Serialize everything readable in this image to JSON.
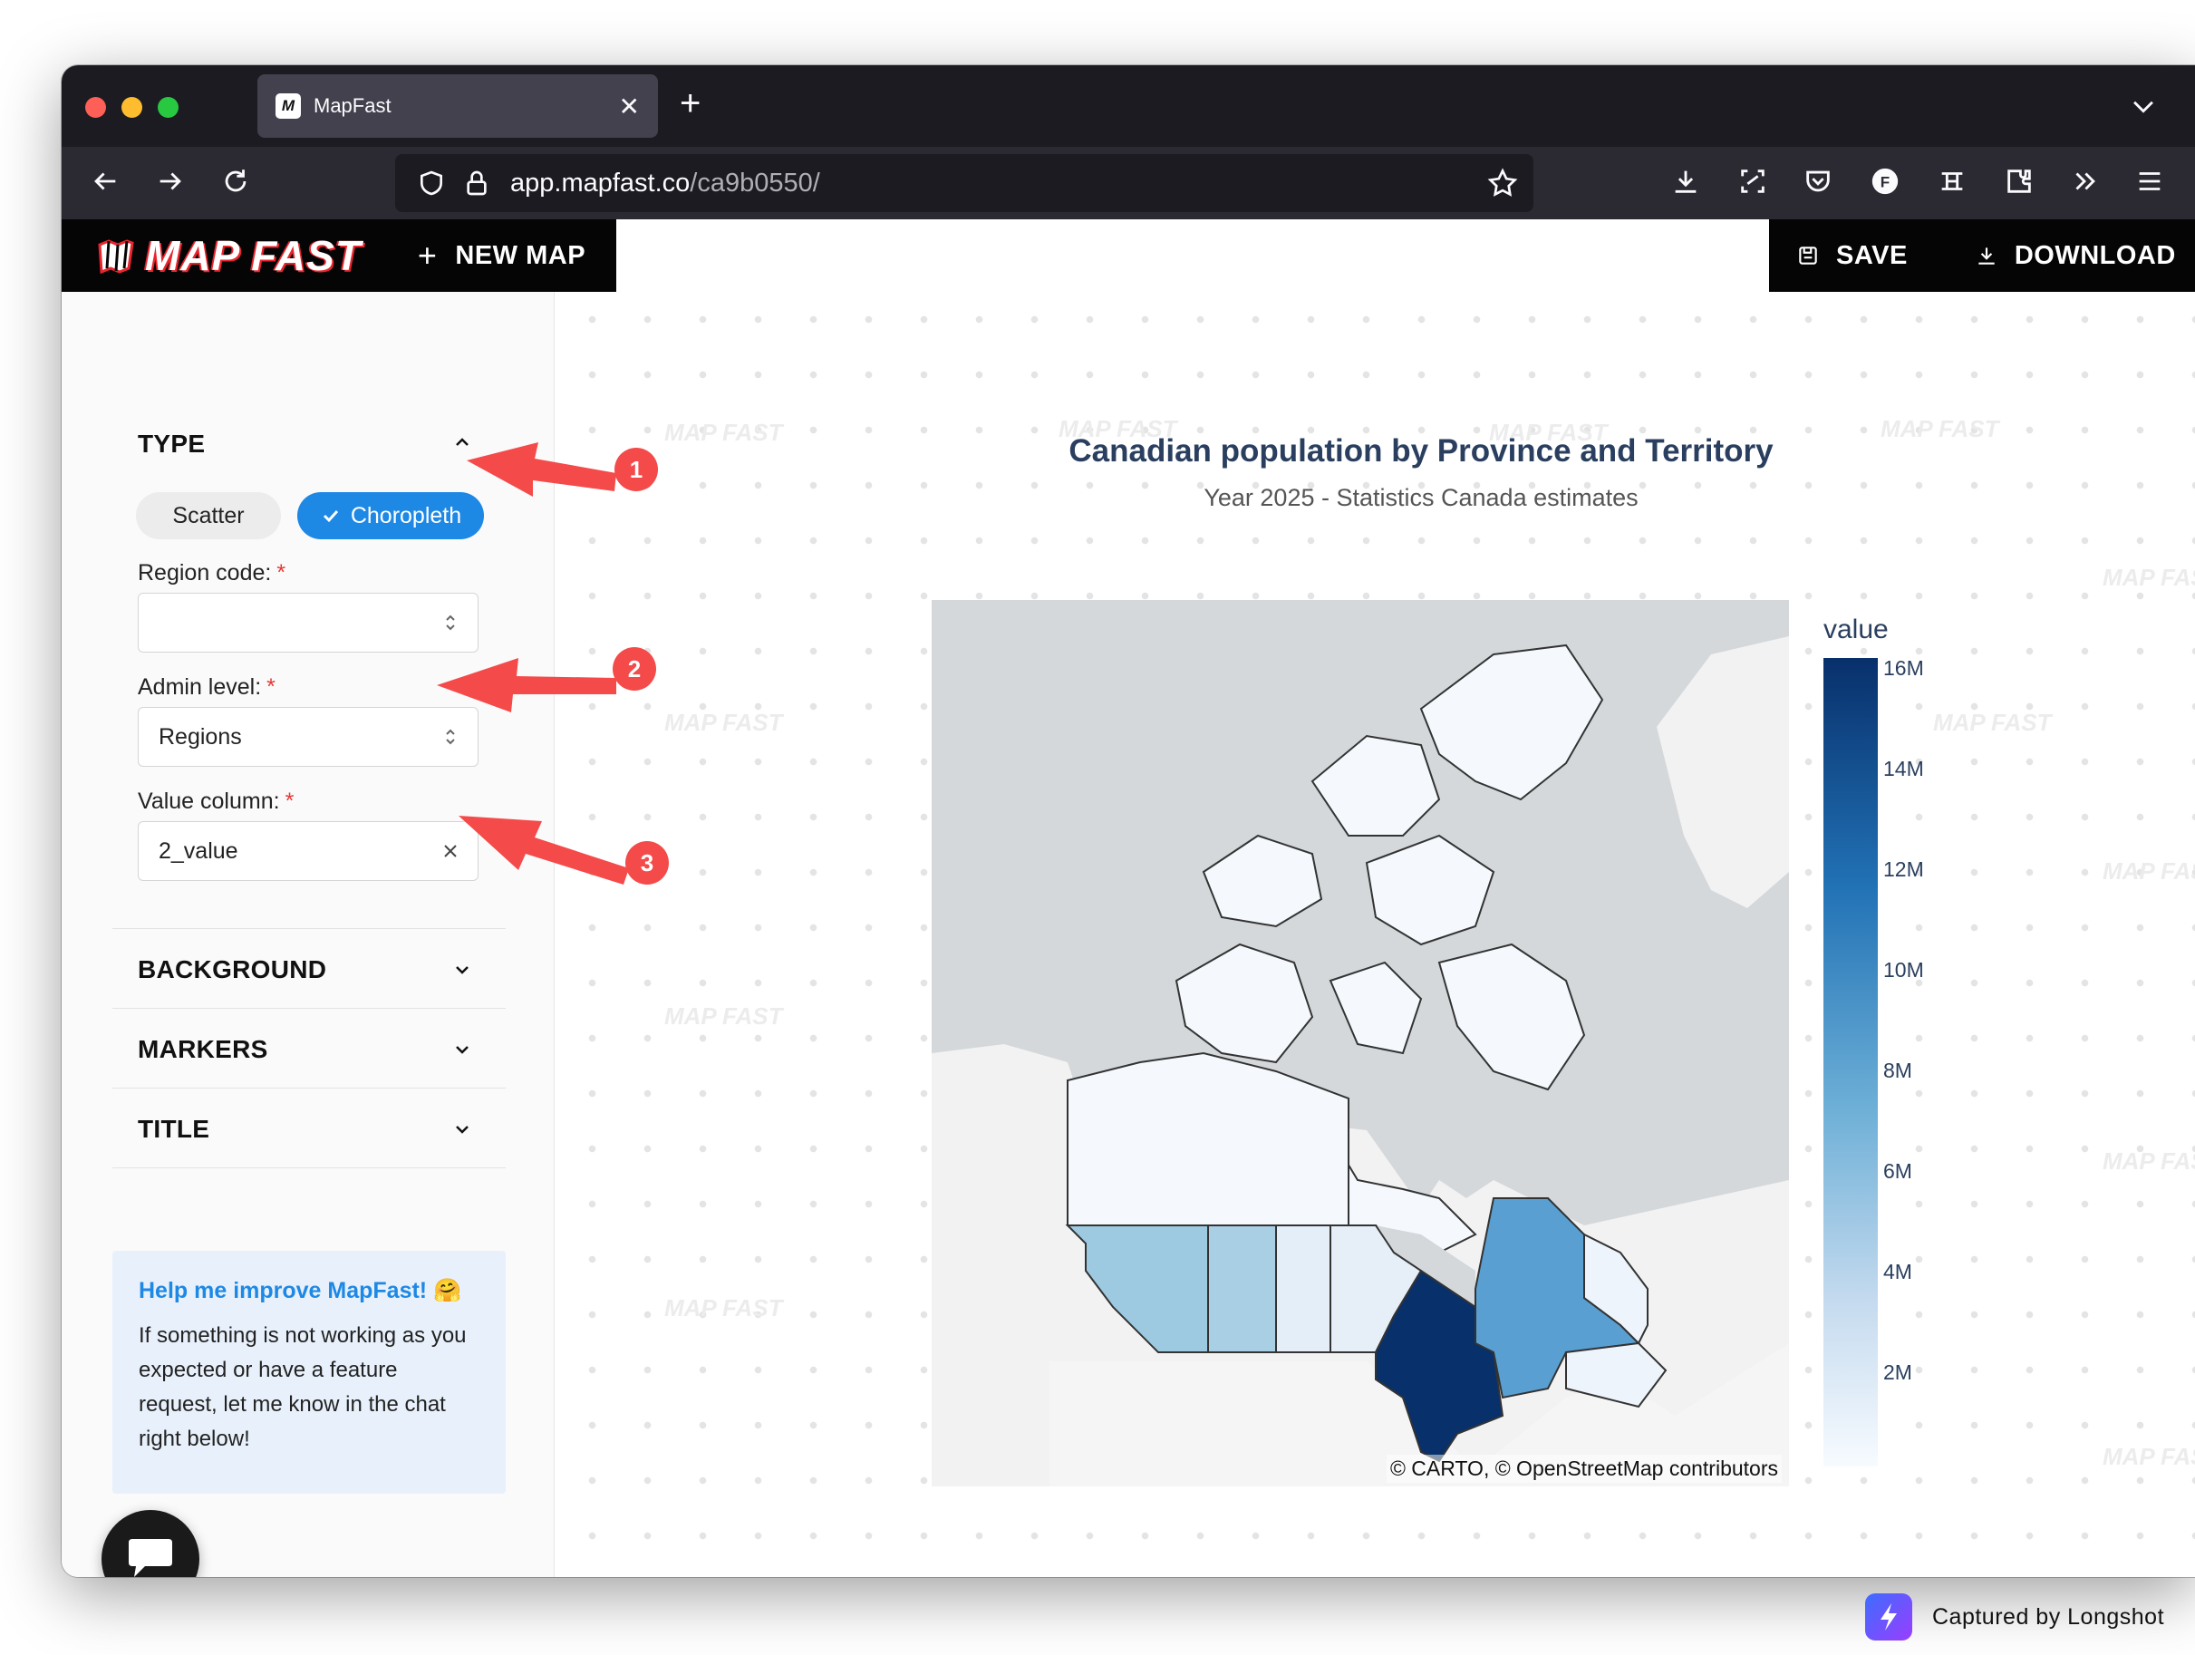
{
  "browser": {
    "tab_title": "MapFast",
    "url_host": "app.mapfast.co",
    "url_path": "/ca9b0550/"
  },
  "appbar": {
    "logo_text": "MAP FAST",
    "new_map_label": "NEW MAP",
    "save_label": "SAVE",
    "download_label": "DOWNLOAD"
  },
  "sidebar": {
    "type_section": {
      "title": "TYPE",
      "options": [
        "Scatter",
        "Choropleth"
      ],
      "selected": "Choropleth"
    },
    "region_code": {
      "label": "Region code:",
      "value": ""
    },
    "admin_level": {
      "label": "Admin level:",
      "value": "Regions"
    },
    "value_column": {
      "label": "Value column:",
      "value": "2_value"
    },
    "required_marker": "*",
    "sections": [
      "BACKGROUND",
      "MARKERS",
      "TITLE"
    ],
    "help": {
      "title": "Help me improve MapFast! 🤗",
      "body": "If something is not working as you expected or have a feature request, let me know in the chat right below!"
    }
  },
  "watermark_text": "MAP FAST",
  "chart": {
    "title": "Canadian population by Province and Territory",
    "subtitle": "Year 2025 - Statistics Canada estimates",
    "attribution": "© CARTO, © OpenStreetMap contributors",
    "colorbar_title": "value",
    "colorbar_ticks": [
      "16M",
      "14M",
      "12M",
      "10M",
      "8M",
      "6M",
      "4M",
      "2M"
    ]
  },
  "chart_data": {
    "type": "choropleth",
    "colorscale": "Blues",
    "colorbar_title": "value",
    "colorbar_range": [
      0,
      16500000
    ],
    "regions": [
      {
        "name": "British Columbia",
        "fill": "#9ecae1"
      },
      {
        "name": "Alberta",
        "fill": "#a9cfe5"
      },
      {
        "name": "Saskatchewan",
        "fill": "#e3eef9"
      },
      {
        "name": "Manitoba",
        "fill": "#e6eff8"
      },
      {
        "name": "Ontario",
        "fill": "#08306b"
      },
      {
        "name": "Quebec",
        "fill": "#5a9fd2"
      },
      {
        "name": "Atlantic provinces",
        "fill": "#eef4fb"
      },
      {
        "name": "Territories",
        "fill": "#f5f9fd"
      }
    ]
  },
  "annotations": [
    "1",
    "2",
    "3"
  ],
  "colors": {
    "accent_blue": "#1e88e5",
    "annotation_red": "#f44a4a",
    "header_black": "#050505",
    "title_navy": "#2a3f5f"
  },
  "capture": {
    "label": "Captured by Longshot"
  }
}
